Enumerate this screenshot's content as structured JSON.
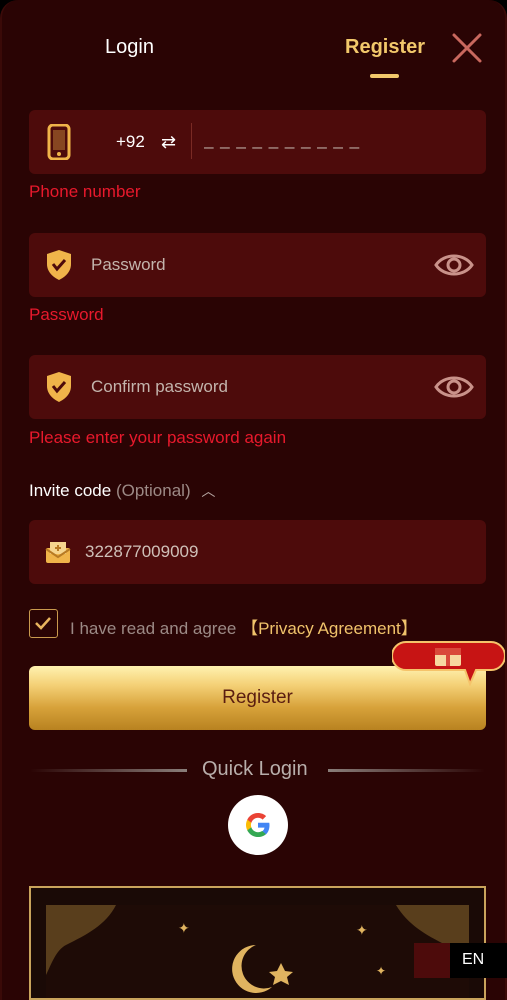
{
  "tabs": {
    "login": "Login",
    "register": "Register"
  },
  "phone": {
    "country_code": "+92",
    "placeholder": "_ _ _ _ _ _ _ _ _ _",
    "error": "Phone number"
  },
  "password": {
    "placeholder": "Password",
    "error": "Password"
  },
  "confirm": {
    "placeholder": "Confirm password",
    "error": "Please enter your password again"
  },
  "invite": {
    "label": "Invite code",
    "optional": "(Optional)",
    "value": "322877009009"
  },
  "agreement": {
    "text": "I have read and agree ",
    "link": "【Privacy Agreement】",
    "checked": true
  },
  "register_button": "Register",
  "quick_login": "Quick Login",
  "language": "EN",
  "colors": {
    "background": "#2a0404",
    "field": "#4d0b0b",
    "accent": "#f2c86b",
    "error": "#e8192c"
  }
}
